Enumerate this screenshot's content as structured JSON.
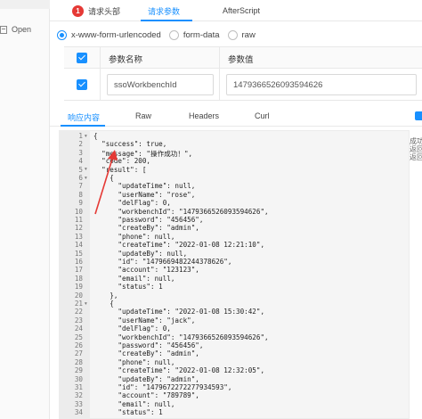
{
  "sidebar": {
    "items": [
      {
        "label": ""
      },
      {
        "label": "Open"
      }
    ]
  },
  "request_tabs": [
    {
      "label": "请求头部",
      "badge": "1"
    },
    {
      "label": "请求参数"
    },
    {
      "label": "AfterScript"
    }
  ],
  "body_types": [
    {
      "label": "x-www-form-urlencoded",
      "checked": true
    },
    {
      "label": "form-data",
      "checked": false
    },
    {
      "label": "raw",
      "checked": false
    }
  ],
  "params_table": {
    "headers": [
      "参数名称",
      "参数值"
    ],
    "rows": [
      {
        "name": "ssoWorkbenchId",
        "value": "1479366526093594626",
        "checked": true
      }
    ]
  },
  "response_tabs": [
    {
      "label": "响应内容"
    },
    {
      "label": "Raw"
    },
    {
      "label": "Headers"
    },
    {
      "label": "Curl"
    }
  ],
  "side_texts": [
    "成功",
    "返回",
    "返回"
  ],
  "code_lines": [
    {
      "n": "1",
      "fold": true,
      "text": "{"
    },
    {
      "n": "2",
      "text": "  \"success\": true,"
    },
    {
      "n": "3",
      "text": "  \"message\": \"操作成功！\","
    },
    {
      "n": "4",
      "text": "  \"code\": 200,"
    },
    {
      "n": "5",
      "fold": true,
      "text": "  \"result\": ["
    },
    {
      "n": "6",
      "fold": true,
      "text": "    {"
    },
    {
      "n": "7",
      "text": "      \"updateTime\": null,"
    },
    {
      "n": "8",
      "text": "      \"userName\": \"rose\","
    },
    {
      "n": "9",
      "text": "      \"delFlag\": 0,"
    },
    {
      "n": "10",
      "text": "      \"workbenchId\": \"1479366526093594626\","
    },
    {
      "n": "11",
      "text": "      \"password\": \"456456\","
    },
    {
      "n": "12",
      "text": "      \"createBy\": \"admin\","
    },
    {
      "n": "13",
      "text": "      \"phone\": null,"
    },
    {
      "n": "14",
      "text": "      \"createTime\": \"2022-01-08 12:21:10\","
    },
    {
      "n": "15",
      "text": "      \"updateBy\": null,"
    },
    {
      "n": "16",
      "text": "      \"id\": \"1479669482244378626\","
    },
    {
      "n": "17",
      "text": "      \"account\": \"123123\","
    },
    {
      "n": "18",
      "text": "      \"email\": null,"
    },
    {
      "n": "19",
      "text": "      \"status\": 1"
    },
    {
      "n": "20",
      "text": "    },"
    },
    {
      "n": "21",
      "fold": true,
      "text": "    {"
    },
    {
      "n": "22",
      "text": "      \"updateTime\": \"2022-01-08 15:30:42\","
    },
    {
      "n": "23",
      "text": "      \"userName\": \"jack\","
    },
    {
      "n": "24",
      "text": "      \"delFlag\": 0,"
    },
    {
      "n": "25",
      "text": "      \"workbenchId\": \"1479366526093594626\","
    },
    {
      "n": "26",
      "text": "      \"password\": \"456456\","
    },
    {
      "n": "27",
      "text": "      \"createBy\": \"admin\","
    },
    {
      "n": "28",
      "text": "      \"phone\": null,"
    },
    {
      "n": "29",
      "text": "      \"createTime\": \"2022-01-08 12:32:05\","
    },
    {
      "n": "30",
      "text": "      \"updateBy\": \"admin\","
    },
    {
      "n": "31",
      "text": "      \"id\": \"1479672272277934593\","
    },
    {
      "n": "32",
      "text": "      \"account\": \"789789\","
    },
    {
      "n": "33",
      "text": "      \"email\": null,"
    },
    {
      "n": "34",
      "text": "      \"status\": 1"
    }
  ],
  "colors": {
    "accent": "#1890ff",
    "badge": "#e53935",
    "arrow": "#e53935"
  }
}
